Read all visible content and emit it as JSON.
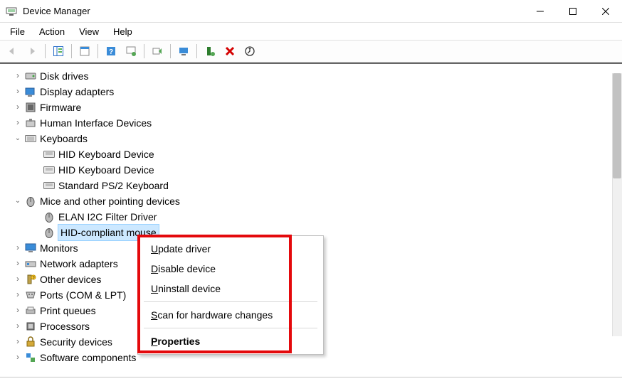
{
  "window": {
    "title": "Device Manager"
  },
  "menu": {
    "file": "File",
    "action": "Action",
    "view": "View",
    "help": "Help"
  },
  "tree": {
    "disk_drives": "Disk drives",
    "display_adapters": "Display adapters",
    "firmware": "Firmware",
    "hid": "Human Interface Devices",
    "keyboards": "Keyboards",
    "kb_children": [
      "HID Keyboard Device",
      "HID Keyboard Device",
      "Standard PS/2 Keyboard"
    ],
    "mice": "Mice and other pointing devices",
    "mice_children": [
      "ELAN I2C Filter Driver",
      "HID-compliant mouse"
    ],
    "monitors": "Monitors",
    "network": "Network adapters",
    "other": "Other devices",
    "ports": "Ports (COM & LPT)",
    "print_queues": "Print queues",
    "processors": "Processors",
    "security": "Security devices",
    "software_components": "Software components"
  },
  "context_menu": {
    "update": "pdate driver",
    "disable": "isable device",
    "uninstall": "ninstall device",
    "scan": "can for hardware changes",
    "properties": "roperties"
  }
}
